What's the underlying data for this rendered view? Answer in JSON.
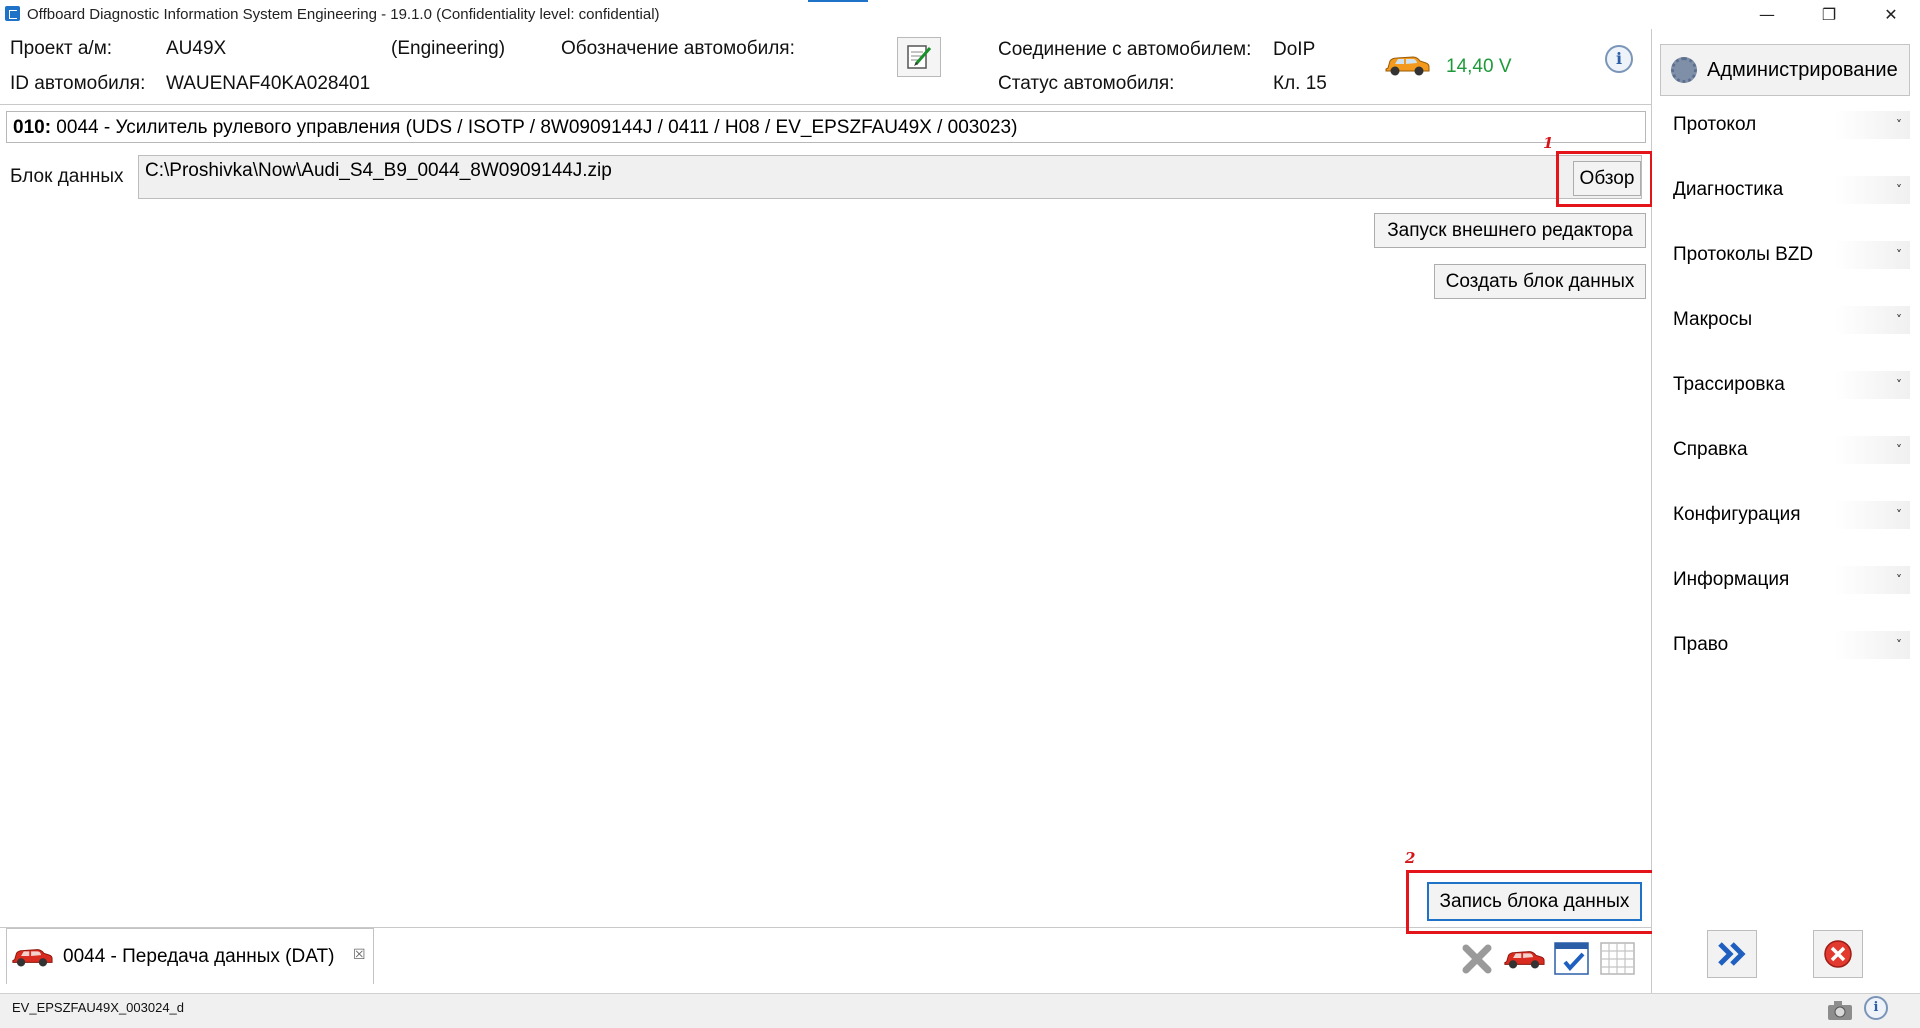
{
  "window": {
    "title": "Offboard Diagnostic Information System Engineering - 19.1.0 (Confidentiality level: confidential)",
    "controls": [
      "—",
      "❐",
      "✕"
    ]
  },
  "header": {
    "project_label": "Проект а/м:",
    "project_value": "AU49X",
    "project_mode": "(Engineering)",
    "designation_label": "Обозначение автомобиля:",
    "vehicle_id_label": "ID автомобиля:",
    "vehicle_id_value": "WAUENAF40KA028401",
    "connection_label": "Соединение с автомобилем:",
    "connection_value": "DoIP",
    "status_label": "Статус автомобиля:",
    "status_value": "Кл. 15",
    "voltage": "14,40 V",
    "info_glyph": "i"
  },
  "main": {
    "ecu_address": "010:",
    "ecu_text": " 0044 - Усилитель рулевого управления  (UDS / ISOTP / 8W0909144J / 0411 / H08 / EV_EPSZFAU49X / 003023)",
    "data_block_label": "Блок данных",
    "data_block_path": "C:\\Proshivka\\Now\\Audi_S4_B9_0044_8W0909144J.zip",
    "browse_button": "Обзор",
    "external_editor_button": "Запуск внешнего редактора",
    "create_block_button": "Создать блок данных",
    "write_block_button": "Запись блока данных",
    "marker_1": "1",
    "marker_2": "2"
  },
  "sidebar": {
    "admin_label": "Администрирование",
    "items": [
      {
        "label": "Протокол"
      },
      {
        "label": "Диагностика"
      },
      {
        "label": "Протоколы BZD"
      },
      {
        "label": "Макросы"
      },
      {
        "label": "Трассировка"
      },
      {
        "label": "Справка"
      },
      {
        "label": "Конфигурация"
      },
      {
        "label": "Информация"
      },
      {
        "label": "Право"
      }
    ],
    "chevron": "˅"
  },
  "tab": {
    "label": "0044 - Передача данных (DAT)",
    "close_glyph": "☒"
  },
  "status_bar": {
    "text": "EV_EPSZFAU49X_003024_d"
  },
  "colors": {
    "voltage": "#1f9a3b",
    "highlight": "#e3151a",
    "primary_border": "#1e73c8"
  }
}
